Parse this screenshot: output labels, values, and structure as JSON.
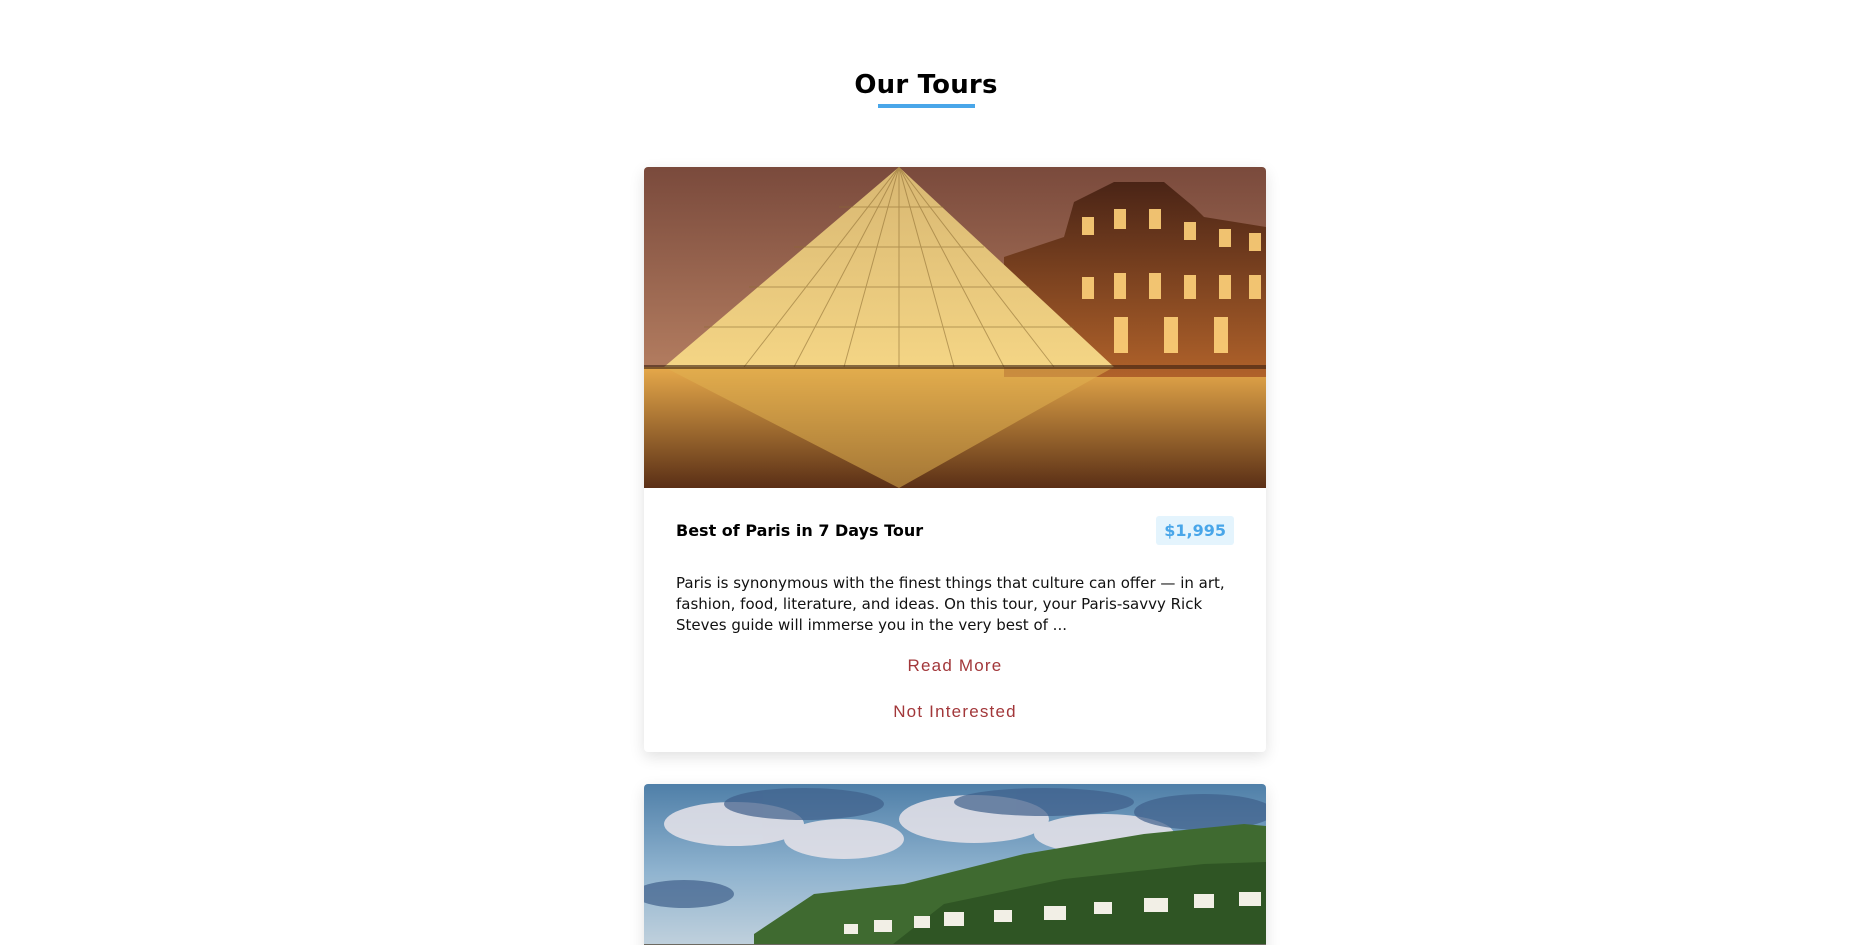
{
  "page": {
    "title": "Our Tours",
    "accent_color": "#49a6e9",
    "button_color": "#a2373a"
  },
  "tours": [
    {
      "name": "Best of Paris in 7 Days Tour",
      "price": "$1,995",
      "description": "Paris is synonymous with the finest things that culture can offer — in art, fashion, food, literature, and ideas. On this tour, your Paris-savvy Rick Steves guide will immerse you in the very best of ...",
      "read_more_label": "Read More",
      "not_interested_label": "Not Interested",
      "image": "louvre-pyramid-at-night"
    },
    {
      "image": "coastal-town-with-green-hills-under-cloudy-sky"
    }
  ]
}
